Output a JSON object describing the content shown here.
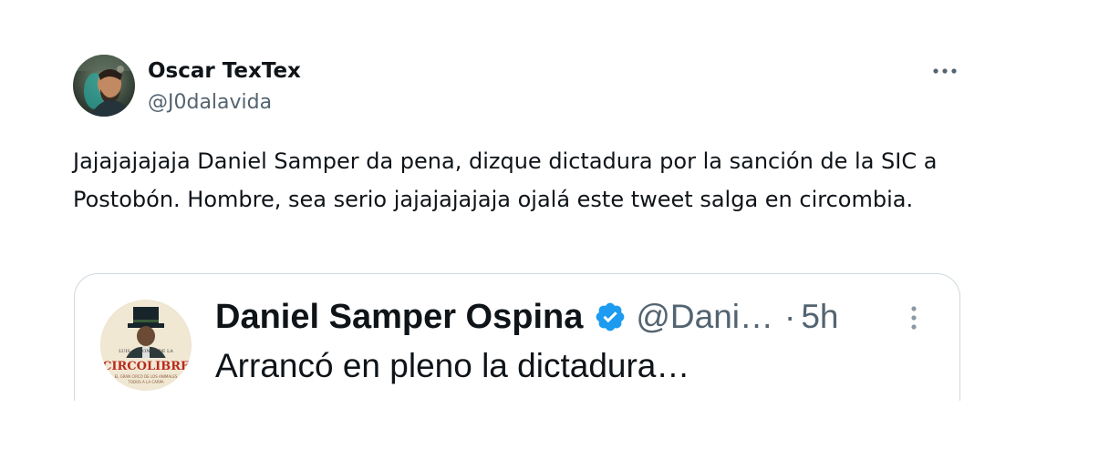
{
  "author": {
    "display_name": "Oscar TexTex",
    "handle": "@J0dalavida",
    "avatar_icon": "profile-photo-avatar"
  },
  "more_icon": "more-horizontal-icon",
  "tweet": {
    "text": "Jajajajajaja Daniel Samper da pena, dizque dictadura por la sanción de la SIC a Postobón. Hombre, sea serio jajajajajaja ojalá este tweet salga en circombia."
  },
  "quoted": {
    "display_name": "Daniel Samper Ospina",
    "handle": "@Dani…",
    "separator": "·",
    "time": "5h",
    "text": "Arrancó en pleno la dictadura…",
    "avatar_icon": "circo-libre-avatar",
    "avatar_text": "CIRCOLIBRE",
    "verified_icon": "verified-badge-icon",
    "more_icon": "more-vertical-icon"
  },
  "colors": {
    "primary_text": "#0f1419",
    "secondary_text": "#536471",
    "verified_blue": "#1d9bf0",
    "border": "#cfd9de"
  }
}
